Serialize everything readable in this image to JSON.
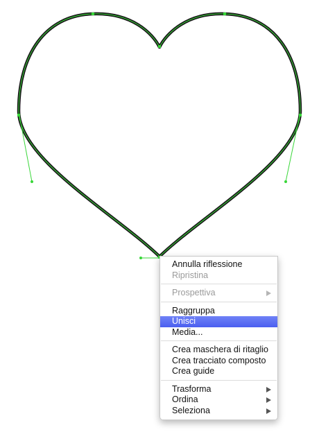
{
  "context_menu": {
    "groups": [
      [
        {
          "label": "Annulla riflessione",
          "disabled": false
        },
        {
          "label": "Ripristina",
          "disabled": true
        }
      ],
      [
        {
          "label": "Prospettiva",
          "disabled": true,
          "submenu": true
        }
      ],
      [
        {
          "label": "Raggruppa",
          "disabled": false
        },
        {
          "label": "Unisci",
          "disabled": false,
          "highlighted": true
        },
        {
          "label": "Media...",
          "disabled": false
        }
      ],
      [
        {
          "label": "Crea maschera di ritaglio",
          "disabled": false
        },
        {
          "label": "Crea tracciato composto",
          "disabled": false
        },
        {
          "label": "Crea guide",
          "disabled": false
        }
      ],
      [
        {
          "label": "Trasforma",
          "disabled": false,
          "submenu": true
        },
        {
          "label": "Ordina",
          "disabled": false,
          "submenu": true
        },
        {
          "label": "Seleziona",
          "disabled": false,
          "submenu": true
        }
      ]
    ]
  },
  "colors": {
    "heart_stroke": "#1a1a1a",
    "selection_path": "#39d639",
    "menu_highlight": "#5068f2"
  }
}
